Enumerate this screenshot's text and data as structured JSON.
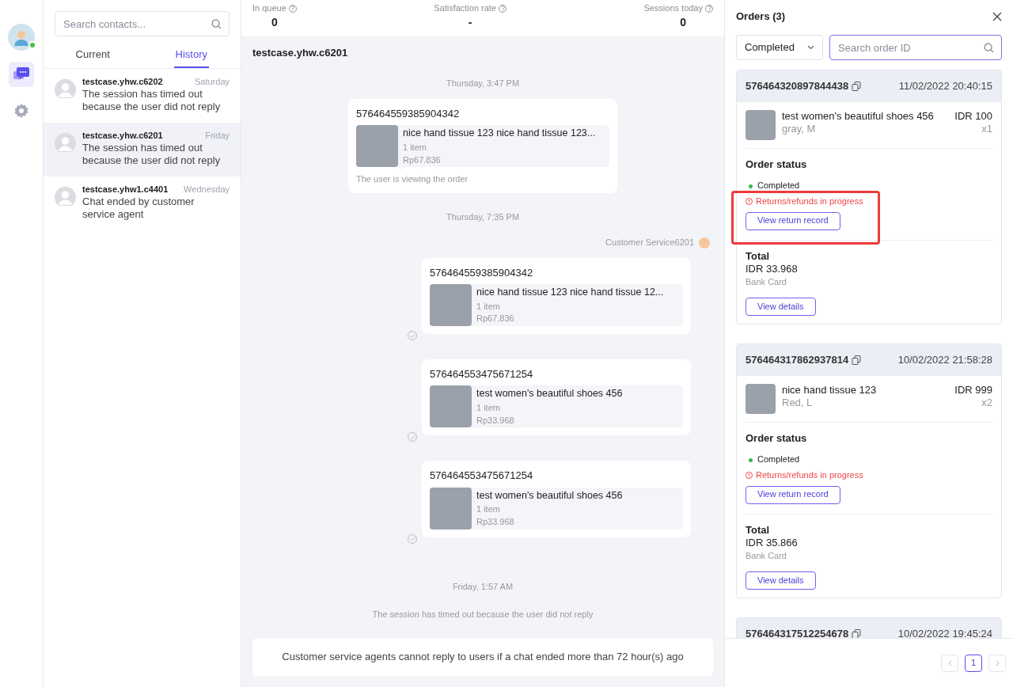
{
  "rail": [
    {
      "kind": "avatar",
      "online": true
    },
    {
      "kind": "chat",
      "selected": true
    },
    {
      "kind": "settings",
      "selected": false
    }
  ],
  "contacts": {
    "search": {
      "placeholder": "Search contacts..."
    },
    "tabs": [
      {
        "label": "Current",
        "selected": false
      },
      {
        "label": "History",
        "selected": true
      }
    ],
    "items": [
      {
        "name": "testcase.yhw.c6202",
        "time": "Saturday",
        "preview": "The session has timed out because the user did not reply",
        "selected": false
      },
      {
        "name": "testcase.yhw.c6201",
        "time": "Friday",
        "preview": "The session has timed out because the user did not reply",
        "selected": true
      },
      {
        "name": "testcase.yhw1.c4401",
        "time": "Wednesday",
        "preview": "Chat ended by customer service agent",
        "selected": false
      }
    ]
  },
  "stats": [
    {
      "label": "In queue",
      "value": "0"
    },
    {
      "label": "Satisfaction rate",
      "value": "-"
    },
    {
      "label": "Sessions today",
      "value": "0"
    }
  ],
  "chat": {
    "title": "testcase.yhw.c6201",
    "messages": [
      {
        "kind": "time",
        "text": "Thursday, 3:47 PM"
      },
      {
        "kind": "user_order",
        "order_id": "576464559385904342",
        "product": "nice hand tissue 123 nice hand tissue 123...",
        "count": "1 item",
        "price": "Rp67.836",
        "note": "The user is viewing the order"
      },
      {
        "kind": "time",
        "text": "Thursday, 7:35 PM"
      },
      {
        "kind": "agent_label",
        "text": "Customer Service6201"
      },
      {
        "kind": "agent_order",
        "order_id": "576464559385904342",
        "product": "nice hand tissue 123 nice hand tissue 12...",
        "count": "1 item",
        "price": "Rp67.836"
      },
      {
        "kind": "agent_order",
        "order_id": "576464553475671254",
        "product": "test women's beautiful shoes 456",
        "count": "1 item",
        "price": "Rp33.968"
      },
      {
        "kind": "agent_order",
        "order_id": "576464553475671254",
        "product": "test women's beautiful shoes 456",
        "count": "1 item",
        "price": "Rp33.968"
      },
      {
        "kind": "time",
        "text": "Friday, 1:57 AM"
      },
      {
        "kind": "system",
        "text": "The session has timed out because the user did not reply"
      }
    ],
    "notice": "Customer service agents cannot reply to users if a chat ended more than 72 hour(s) ago"
  },
  "orders": {
    "title": "Orders (3)",
    "filter": "Completed",
    "search": {
      "placeholder": "Search order ID"
    },
    "items": [
      {
        "order_id": "576464320897844438",
        "date": "11/02/2022 20:40:15",
        "product": "test women's beautiful shoes 456",
        "variant": "gray, M",
        "price": "IDR 100",
        "qty": "x1",
        "status_heading": "Order status",
        "status": "Completed",
        "alert": "Returns/refunds in progress",
        "return_button": "View return record",
        "highlighted": true,
        "total_heading": "Total",
        "total": "IDR 33.968",
        "payment": "Bank Card",
        "details_button": "View details"
      },
      {
        "order_id": "576464317862937814",
        "date": "10/02/2022 21:58:28",
        "product": "nice hand tissue 123",
        "variant": "Red, L",
        "price": "IDR 999",
        "qty": "x2",
        "status_heading": "Order status",
        "status": "Completed",
        "alert": "Returns/refunds in progress",
        "return_button": "View return record",
        "highlighted": false,
        "total_heading": "Total",
        "total": "IDR 35.866",
        "payment": "Bank Card",
        "details_button": "View details"
      },
      {
        "order_id": "576464317512254678",
        "date": "10/02/2022 19:45:24"
      }
    ],
    "pages": [
      {
        "label": "1",
        "selected": true
      }
    ]
  }
}
